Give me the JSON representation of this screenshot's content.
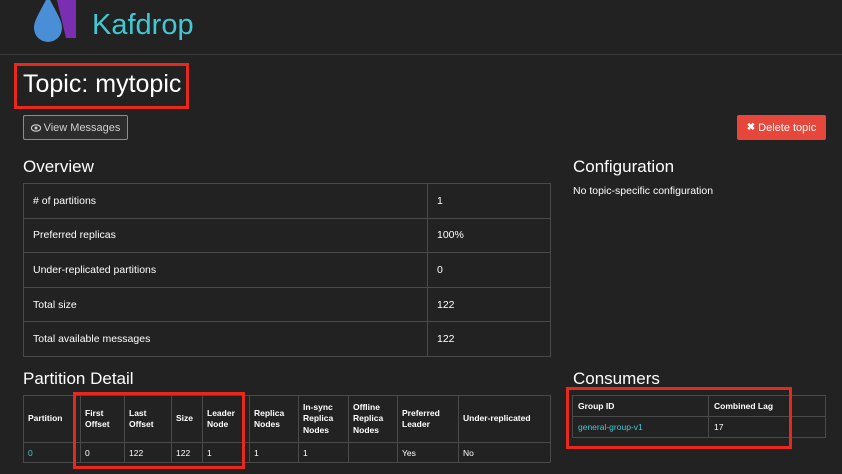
{
  "header": {
    "brand": "Kafdrop",
    "logo_icon": "kafdrop-logo-icon"
  },
  "page": {
    "title": "Topic: mytopic"
  },
  "actions": {
    "view_messages": "View Messages",
    "view_messages_icon": "eye-icon",
    "delete_topic": "Delete topic",
    "delete_topic_icon": "x-icon"
  },
  "colors": {
    "accent": "#40c9d4",
    "danger": "#e7473a",
    "highlight": "#e8281c",
    "background": "#222222"
  },
  "overview": {
    "title": "Overview",
    "rows": [
      {
        "key": "# of partitions",
        "value": "1"
      },
      {
        "key": "Preferred replicas",
        "value": "100%"
      },
      {
        "key": "Under-replicated partitions",
        "value": "0"
      },
      {
        "key": "Total size",
        "value": "122"
      },
      {
        "key": "Total available messages",
        "value": "122"
      }
    ]
  },
  "configuration": {
    "title": "Configuration",
    "text": "No topic-specific configuration"
  },
  "partition_detail": {
    "title": "Partition Detail",
    "headers": {
      "partition": "Partition",
      "first_offset_1": "First",
      "first_offset_2": "Offset",
      "last_offset_1": "Last",
      "last_offset_2": "Offset",
      "size": "Size",
      "leader_1": "Leader",
      "leader_2": "Node",
      "replica_1": "Replica",
      "replica_2": "Nodes",
      "insync_1": "In-sync",
      "insync_2": "Replica",
      "insync_3": "Nodes",
      "offline_1": "Offline",
      "offline_2": "Replica",
      "offline_3": "Nodes",
      "preferred_1": "Preferred",
      "preferred_2": "Leader",
      "under_replicated": "Under-replicated"
    },
    "rows": [
      {
        "partition": "0",
        "first_offset": "0",
        "last_offset": "122",
        "size": "122",
        "leader": "1",
        "replicas": "1",
        "insync": "1",
        "offline": "",
        "preferred": "Yes",
        "under_replicated": "No"
      }
    ]
  },
  "consumers": {
    "title": "Consumers",
    "headers": {
      "group_id": "Group ID",
      "combined_lag": "Combined Lag"
    },
    "rows": [
      {
        "group_id": "general-group-v1",
        "combined_lag": "17"
      }
    ]
  }
}
